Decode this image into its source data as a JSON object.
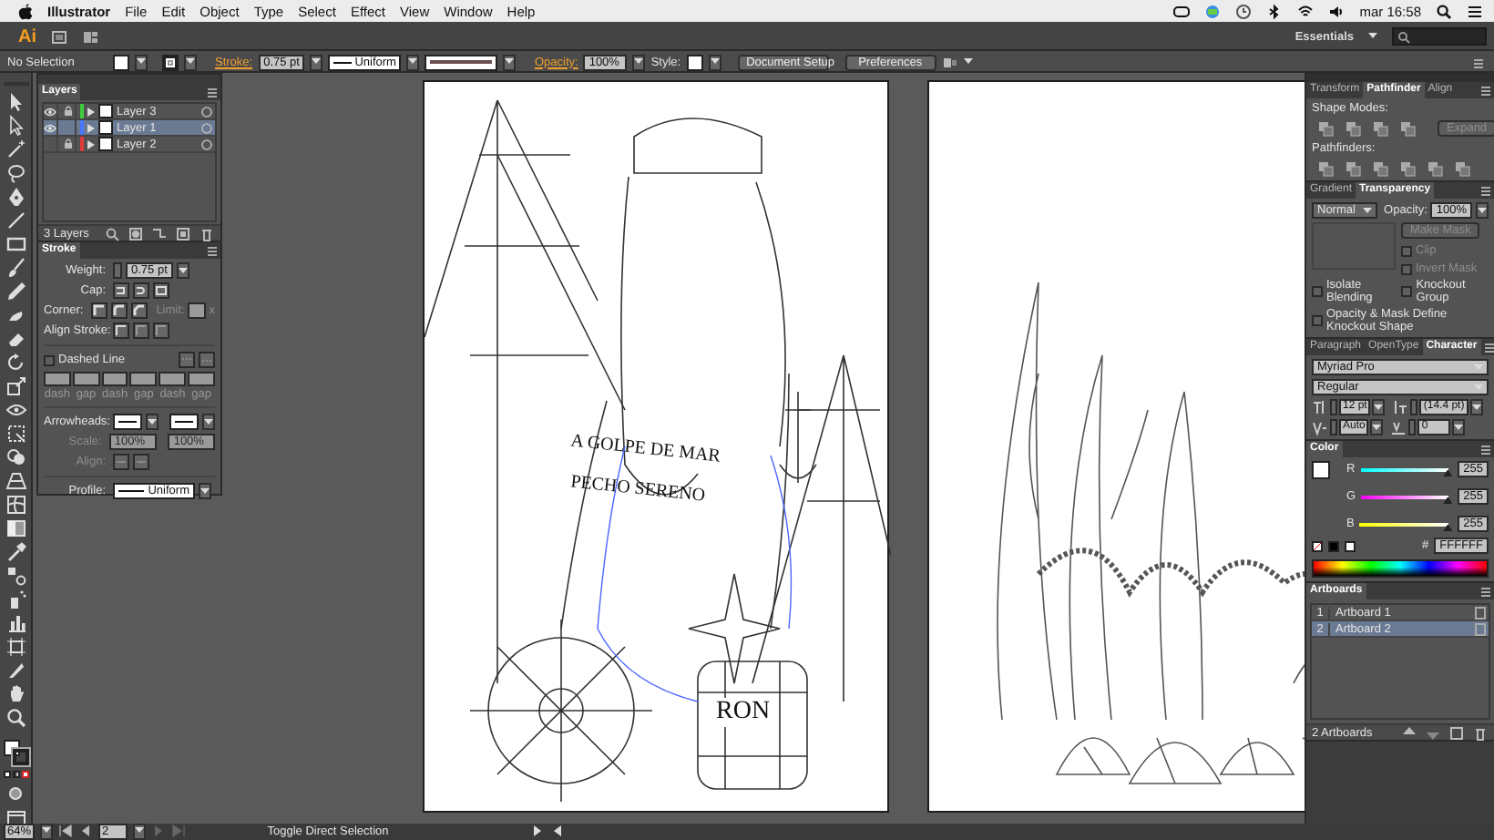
{
  "menubar": {
    "app": "Illustrator",
    "menus": [
      "File",
      "Edit",
      "Object",
      "Type",
      "Select",
      "Effect",
      "View",
      "Window",
      "Help"
    ],
    "clock": "mar 16:58"
  },
  "appbar": {
    "logo": "Ai",
    "workspace": "Essentials"
  },
  "control_bar": {
    "selection": "No Selection",
    "stroke_label": "Stroke:",
    "stroke_weight": "0.75 pt",
    "profile": "Uniform",
    "opacity_label": "Opacity:",
    "opacity": "100%",
    "style_label": "Style:",
    "buttons": [
      "Document Setup",
      "Preferences"
    ]
  },
  "layers_panel": {
    "title": "Layers",
    "layers": [
      {
        "name": "Layer 3",
        "color": "#3ccf3c",
        "visible": true,
        "locked": true,
        "selected": false
      },
      {
        "name": "Layer 1",
        "color": "#4a78ff",
        "visible": true,
        "locked": false,
        "selected": true
      },
      {
        "name": "Layer 2",
        "color": "#e23b3b",
        "visible": false,
        "locked": true,
        "selected": false
      }
    ],
    "count": "3 Layers"
  },
  "stroke_panel": {
    "title": "Stroke",
    "weight_label": "Weight:",
    "weight": "0.75 pt",
    "cap_label": "Cap:",
    "corner_label": "Corner:",
    "limit_label": "Limit:",
    "limit_unit": "x",
    "align_label": "Align Stroke:",
    "dashed_label": "Dashed Line",
    "dashed": false,
    "dash_fields": [
      "dash",
      "gap",
      "dash",
      "gap",
      "dash",
      "gap"
    ],
    "arrowheads_label": "Arrowheads:",
    "scale_label": "Scale:",
    "scale": [
      "100%",
      "100%"
    ],
    "align_arrow_label": "Align:",
    "profile_label": "Profile:",
    "profile": "Uniform"
  },
  "pathfinder_panel": {
    "tabs": [
      {
        "label": "Transform",
        "selected": false
      },
      {
        "label": "Pathfinder",
        "selected": true
      },
      {
        "label": "Align",
        "selected": false
      }
    ],
    "shape_modes_label": "Shape Modes:",
    "expand": "Expand",
    "pathfinders_label": "Pathfinders:"
  },
  "transparency_panel": {
    "tabs": [
      {
        "label": "Gradient",
        "selected": false
      },
      {
        "label": "Transparency",
        "selected": true
      }
    ],
    "blend_mode": "Normal",
    "opacity_label": "Opacity:",
    "opacity": "100%",
    "make_mask": "Make Mask",
    "mask_options": [
      {
        "label": "Clip",
        "checked": false
      },
      {
        "label": "Invert Mask",
        "checked": false
      }
    ],
    "options": [
      {
        "label": "Isolate Blending",
        "checked": false
      },
      {
        "label": "Knockout Group",
        "checked": false
      },
      {
        "label": "Opacity & Mask Define Knockout Shape",
        "checked": false
      }
    ]
  },
  "character_panel": {
    "tabs": [
      {
        "label": "Paragraph",
        "selected": false
      },
      {
        "label": "OpenType",
        "selected": false
      },
      {
        "label": "Character",
        "selected": true
      }
    ],
    "font": "Myriad Pro",
    "style": "Regular",
    "size": "12 pt",
    "leading": "(14.4 pt)",
    "kerning": "Auto",
    "tracking": "0"
  },
  "color_panel": {
    "title": "Color",
    "channels": [
      {
        "kind": "r",
        "label": "R",
        "level": 1,
        "value": "255"
      },
      {
        "kind": "g",
        "label": "G",
        "level": 1,
        "value": "255"
      },
      {
        "kind": "b",
        "label": "B",
        "level": 1,
        "value": "255"
      }
    ],
    "hex_label": "#",
    "hex": "FFFFFF"
  },
  "artboards_panel": {
    "title": "Artboards",
    "items": [
      {
        "number": "1",
        "name": "Artboard 1",
        "selected": false
      },
      {
        "number": "2",
        "name": "Artboard 2",
        "selected": true
      }
    ],
    "count": "2 Artboards"
  },
  "canvas": {
    "lettering": [
      "A GOLPE DE MAR",
      "PECHO SERENO",
      "RON"
    ]
  },
  "status_bar": {
    "zoom": "64%",
    "artboard": "2",
    "message": "Toggle Direct Selection"
  }
}
